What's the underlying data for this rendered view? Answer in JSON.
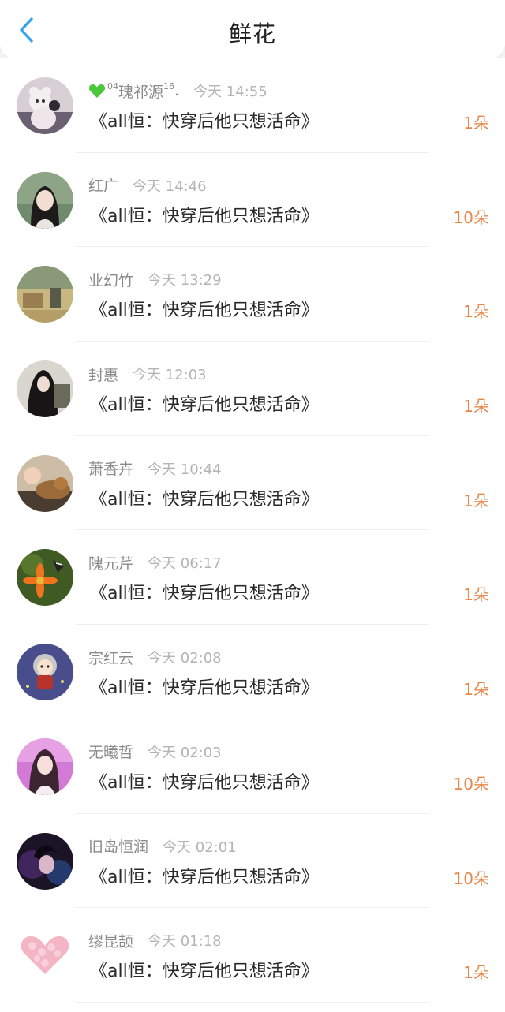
{
  "header": {
    "title": "鲜花",
    "back_icon": "chevron-left-icon",
    "accent": "#3aa3f0"
  },
  "colors": {
    "count": "#e8874a",
    "name": "#8a8a8a",
    "time": "#b4b4b4"
  },
  "items": [
    {
      "name_prefix": "04",
      "name": "瑰祁源",
      "name_suffix": "16",
      "name_tail": ".",
      "heart": true,
      "time": "今天 14:55",
      "book": "《all恒：快穿后他只想活命》",
      "count": "1朵"
    },
    {
      "name": "红广",
      "time": "今天 14:46",
      "book": "《all恒：快穿后他只想活命》",
      "count": "10朵"
    },
    {
      "name": "业幻竹",
      "time": "今天 13:29",
      "book": "《all恒：快穿后他只想活命》",
      "count": "1朵"
    },
    {
      "name": "封惠",
      "time": "今天 12:03",
      "book": "《all恒：快穿后他只想活命》",
      "count": "1朵"
    },
    {
      "name": "萧香卉",
      "time": "今天 10:44",
      "book": "《all恒：快穿后他只想活命》",
      "count": "1朵"
    },
    {
      "name": "隗元芹",
      "time": "今天 06:17",
      "book": "《all恒：快穿后他只想活命》",
      "count": "1朵"
    },
    {
      "name": "宗红云",
      "time": "今天 02:08",
      "book": "《all恒：快穿后他只想活命》",
      "count": "1朵"
    },
    {
      "name": "无曦哲",
      "time": "今天 02:03",
      "book": "《all恒：快穿后他只想活命》",
      "count": "10朵"
    },
    {
      "name": "旧岛恒润",
      "time": "今天 02:01",
      "book": "《all恒：快穿后他只想活命》",
      "count": "10朵"
    },
    {
      "name": "缪昆颉",
      "time": "今天 01:18",
      "book": "《all恒：快穿后他只想活命》",
      "count": "1朵"
    }
  ]
}
